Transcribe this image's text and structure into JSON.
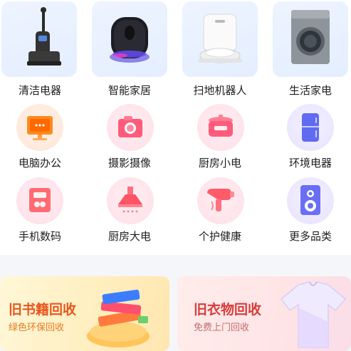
{
  "categories": [
    {
      "label": "清洁电器",
      "icon": "vacuum-cleaner-icon"
    },
    {
      "label": "智能家居",
      "icon": "smart-speaker-icon"
    },
    {
      "label": "扫地机器人",
      "icon": "robot-vacuum-icon"
    },
    {
      "label": "生活家电",
      "icon": "washing-machine-icon"
    },
    {
      "label": "电脑办公",
      "icon": "monitor-icon"
    },
    {
      "label": "摄影摄像",
      "icon": "camera-icon"
    },
    {
      "label": "厨房小电",
      "icon": "rice-cooker-icon"
    },
    {
      "label": "环境电器",
      "icon": "refrigerator-icon"
    },
    {
      "label": "手机数码",
      "icon": "phone-icon"
    },
    {
      "label": "厨房大电",
      "icon": "range-hood-icon"
    },
    {
      "label": "个护健康",
      "icon": "hair-dryer-icon"
    },
    {
      "label": "更多品类",
      "icon": "speaker-icon"
    }
  ],
  "banners": [
    {
      "title": "旧书籍回收",
      "subtitle": "绿色环保回收",
      "icon": "books-icon",
      "title_color": "#e8561e",
      "subtitle_color": "#e8791e"
    },
    {
      "title": "旧衣物回收",
      "subtitle": "免费上门回收",
      "icon": "shirt-icon",
      "title_color": "#d73c3c",
      "subtitle_color": "#c56d6d"
    }
  ]
}
